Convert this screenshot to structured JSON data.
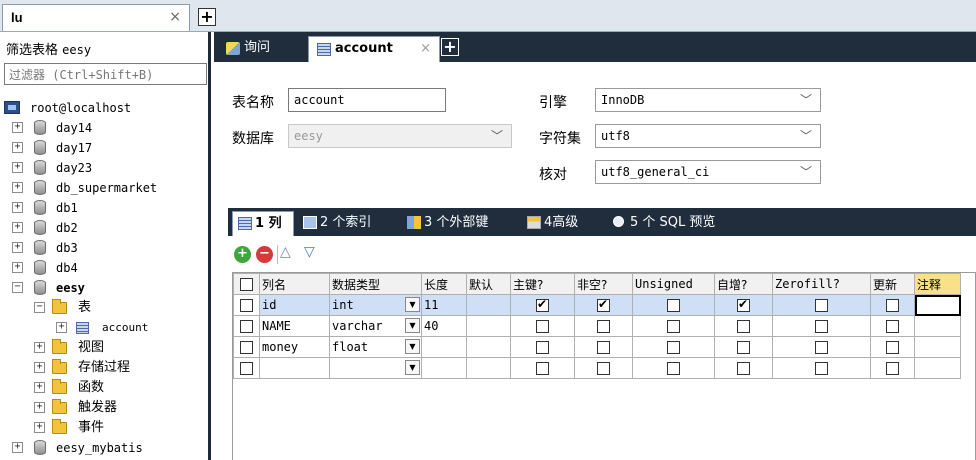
{
  "top": {
    "conn_tab_label": "lu",
    "close_glyph": "×",
    "plus_glyph": "+"
  },
  "navigator": {
    "filter_label": "筛选表格",
    "filter_db": "eesy",
    "filter_placeholder": "过滤器 (Ctrl+Shift+B)",
    "host": "root@localhost",
    "databases": [
      "day14",
      "day17",
      "day23",
      "db_supermarket",
      "db1",
      "db2",
      "db3",
      "db4",
      "eesy"
    ],
    "folders": {
      "tables": "表",
      "views": "视图",
      "procedures": "存储过程",
      "functions": "函数",
      "triggers": "触发器",
      "events": "事件"
    },
    "table_item": "account",
    "next_db": "eesy_mybatis",
    "expand_plus": "+",
    "expand_minus": "−"
  },
  "object_tabs": {
    "query": "询问",
    "account": "account",
    "close": "×",
    "plus": "+"
  },
  "form": {
    "table_name_label": "表名称",
    "table_name_value": "account",
    "database_label": "数据库",
    "database_value": "eesy",
    "engine_label": "引擎",
    "engine_value": "InnoDB",
    "charset_label": "字符集",
    "charset_value": "utf8",
    "collation_label": "核对",
    "collation_value": "utf8_general_ci",
    "arrow": "﹀"
  },
  "sub_tabs": {
    "columns_num": "1",
    "columns_label": "列",
    "indexes": "2 个索引",
    "foreign_keys": "3 个外部键",
    "advanced": "4高级",
    "sql_preview": "5 个 SQL 预览"
  },
  "toolbar": {
    "add": "+",
    "remove": "−",
    "up": "△",
    "down": "▽"
  },
  "grid": {
    "headers": [
      "列名",
      "数据类型",
      "长度",
      "默认",
      "主键?",
      "非空?",
      "Unsigned",
      "自增?",
      "Zerofill?",
      "更新",
      "注释"
    ],
    "rows": [
      {
        "name": "id",
        "type": "int",
        "length": "11",
        "pk": true,
        "notnull": true,
        "autoinc": true
      },
      {
        "name": "NAME",
        "type": "varchar",
        "length": "40",
        "pk": false,
        "notnull": false,
        "autoinc": false
      },
      {
        "name": "money",
        "type": "float",
        "length": "",
        "pk": false,
        "notnull": false,
        "autoinc": false
      },
      {
        "name": "",
        "type": "",
        "length": "",
        "pk": false,
        "notnull": false,
        "autoinc": false
      }
    ],
    "dropdown_glyph": "▼"
  },
  "colors": {
    "tabbar_dark": "#1f2d3d",
    "selection": "#cfe0f6",
    "header_highlight": "#f9e08b"
  }
}
